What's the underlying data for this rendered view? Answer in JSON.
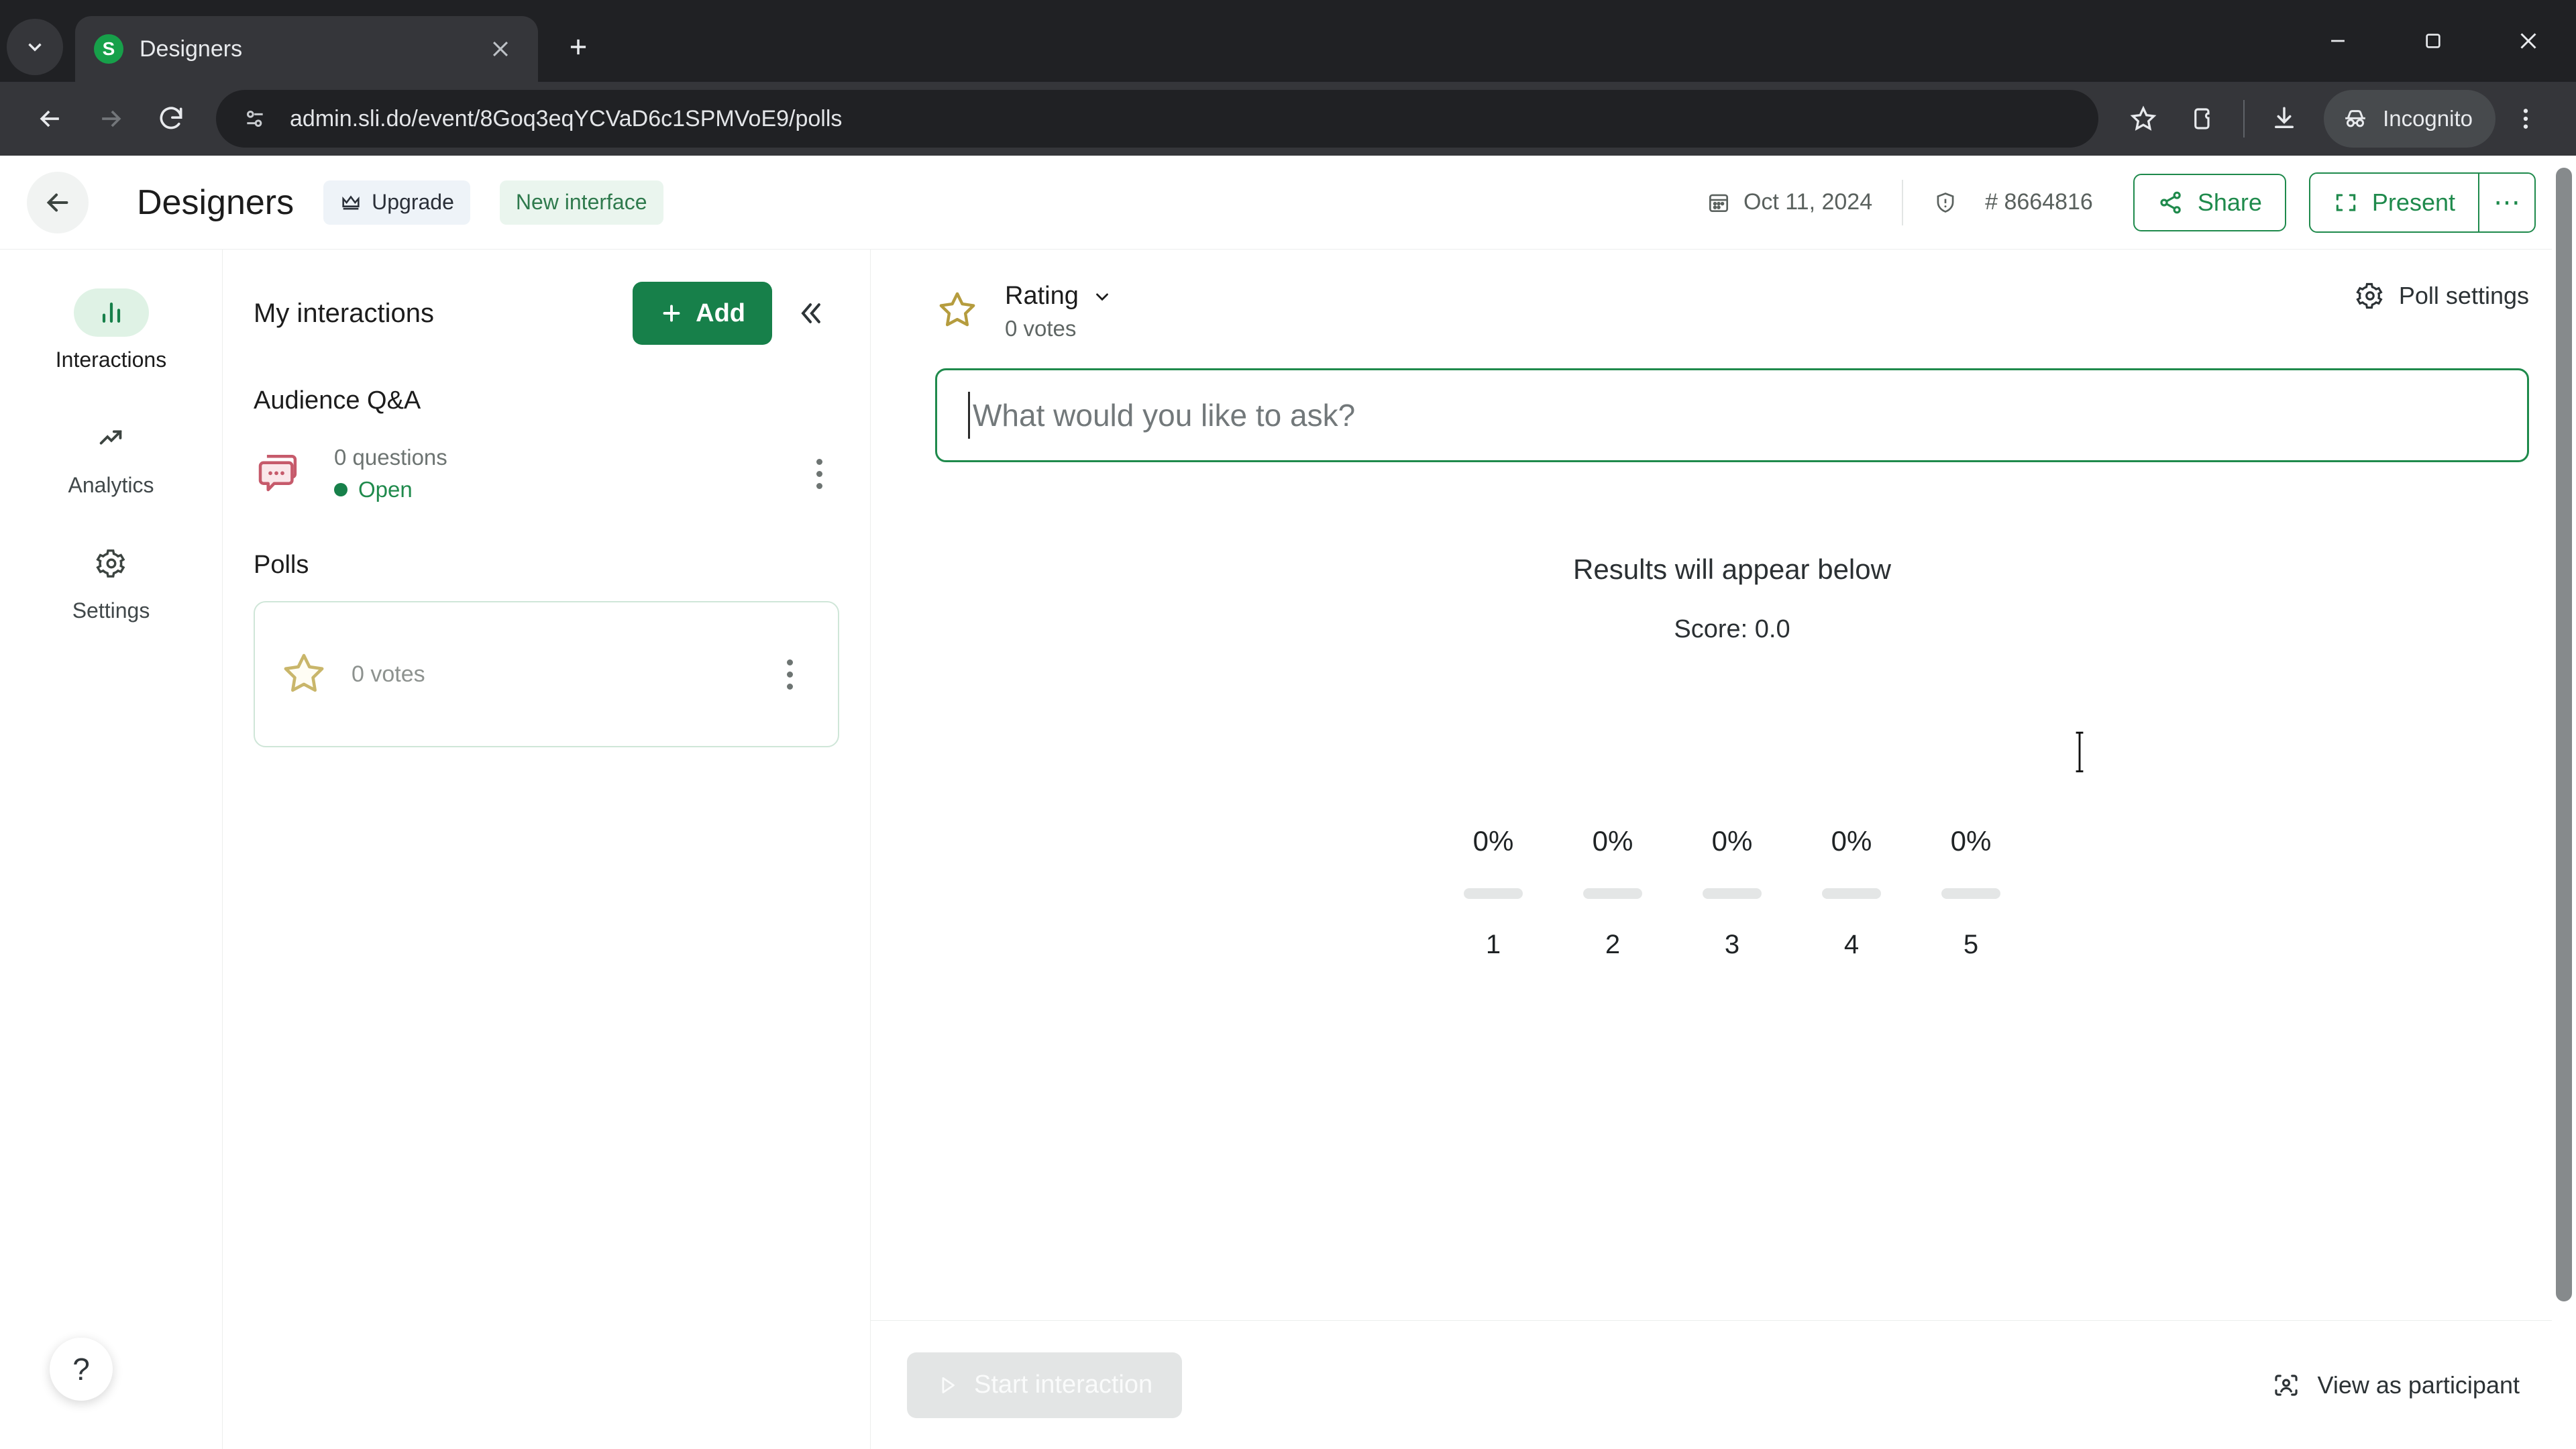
{
  "browser": {
    "tab": {
      "title": "Designers",
      "favicon_letter": "S"
    },
    "url": "admin.sli.do/event/8Goq3eqYCVaD6c1SPMVoE9/polls",
    "profile_label": "Incognito",
    "icons": {
      "tab_search": "chevron-down-icon",
      "close_tab": "close-icon",
      "new_tab": "plus-icon",
      "back": "back-arrow-icon",
      "forward": "forward-arrow-icon",
      "reload": "reload-icon",
      "site_info": "page-settings-icon",
      "bookmark": "star-icon",
      "extensions": "extensions-icon",
      "download": "download-icon",
      "incognito": "incognito-icon",
      "menu": "three-dot-menu-icon",
      "minimize": "minimize-icon",
      "maximize": "maximize-icon",
      "window_close": "window-close-icon"
    }
  },
  "header": {
    "back_label": "←",
    "event_title": "Designers",
    "upgrade_label": "Upgrade",
    "new_interface_label": "New interface",
    "date": "Oct 11, 2024",
    "event_code": "# 8664816",
    "share_label": "Share",
    "present_label": "Present",
    "more_label": "⋯"
  },
  "rail": {
    "items": [
      {
        "label": "Interactions",
        "icon": "bar-chart-icon",
        "active": true
      },
      {
        "label": "Analytics",
        "icon": "trending-up-icon",
        "active": false
      },
      {
        "label": "Settings",
        "icon": "gear-icon",
        "active": false
      }
    ],
    "help_label": "?"
  },
  "panel": {
    "title": "My interactions",
    "add_label": "Add",
    "collapse_label": "«",
    "qa_group_title": "Audience Q&A",
    "qa_item": {
      "count": "0 questions",
      "status": "Open"
    },
    "polls_group_title": "Polls",
    "poll_item": {
      "votes": "0 votes"
    }
  },
  "main": {
    "poll_type": "Rating",
    "poll_votes": "0 votes",
    "poll_settings_label": "Poll settings",
    "ask_placeholder": "What would you like to ask?",
    "ask_value": "",
    "results_title": "Results will appear below",
    "results_score": "Score: 0.0",
    "start_label": "Start interaction",
    "view_participant_label": "View as participant"
  },
  "chart_data": {
    "type": "bar",
    "title": "Results will appear below",
    "subtitle": "Score: 0.0",
    "categories": [
      "1",
      "2",
      "3",
      "4",
      "5"
    ],
    "values": [
      0,
      0,
      0,
      0,
      0
    ],
    "value_labels": [
      "0%",
      "0%",
      "0%",
      "0%",
      "0%"
    ],
    "xlabel": "",
    "ylabel": "",
    "ylim": [
      0,
      100
    ],
    "grid": false,
    "legend": "none",
    "bar_color": "#e4e6e6"
  }
}
